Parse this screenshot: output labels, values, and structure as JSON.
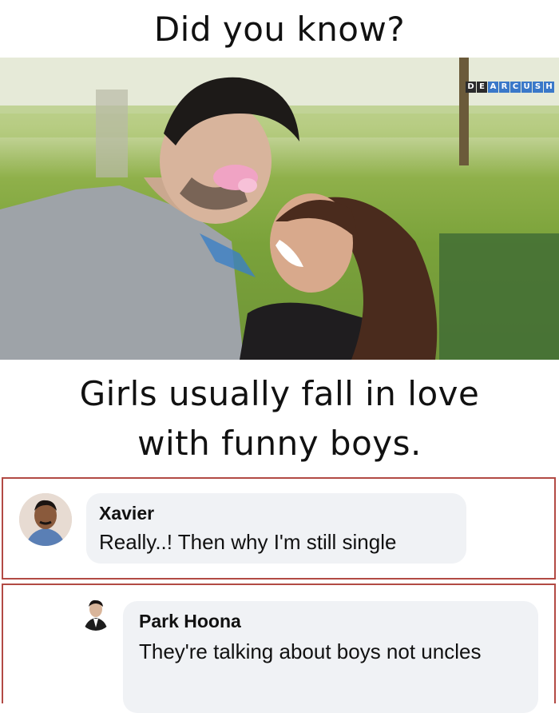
{
  "meme": {
    "headline": "Did you know?",
    "caption_line1": "Girls usually fall in love",
    "caption_line2": "with funny boys.",
    "watermark_letters": [
      "D",
      "E",
      "A",
      "R",
      "C",
      "U",
      "S",
      "H"
    ]
  },
  "comments": [
    {
      "author": "Xavier",
      "text": "Really..! Then why I'm still single"
    },
    {
      "author": "Park Hoona",
      "text": "They're talking about boys not uncles"
    }
  ]
}
